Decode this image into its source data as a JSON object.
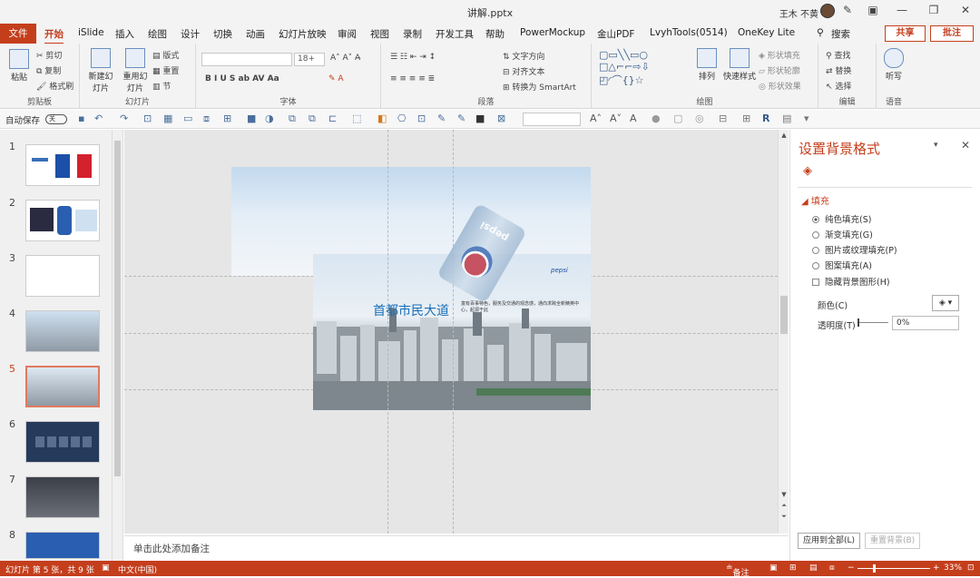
{
  "window": {
    "title": "讲解.pptx",
    "user": "王木 不黄"
  },
  "tabs": [
    {
      "label": "文件"
    },
    {
      "label": "开始"
    },
    {
      "label": "iSlide"
    },
    {
      "label": "插入"
    },
    {
      "label": "绘图"
    },
    {
      "label": "设计"
    },
    {
      "label": "切换"
    },
    {
      "label": "动画"
    },
    {
      "label": "幻灯片放映"
    },
    {
      "label": "审阅"
    },
    {
      "label": "视图"
    },
    {
      "label": "录制"
    },
    {
      "label": "开发工具"
    },
    {
      "label": "帮助"
    },
    {
      "label": "PowerMockup"
    },
    {
      "label": "金山PDF"
    },
    {
      "label": "LvyhTools(0514)"
    },
    {
      "label": "OneKey Lite"
    },
    {
      "label": "搜索"
    }
  ],
  "header_buttons": {
    "share": "共享",
    "comment": "批注"
  },
  "ribbon": {
    "clipboard": {
      "label": "剪贴板",
      "paste": "粘贴",
      "cut": "剪切",
      "copy": "复制",
      "format_painter": "格式刷"
    },
    "slides": {
      "label": "幻灯片",
      "new_slide": "新建幻灯片",
      "reuse": "重用幻灯片",
      "layout": "版式",
      "reset": "重置",
      "section": "节"
    },
    "font": {
      "label": "字体",
      "size": "18+"
    },
    "paragraph": {
      "label": "段落",
      "text_direction": "文字方向",
      "align_text": "对齐文本",
      "smartart": "转换为 SmartArt"
    },
    "drawing": {
      "label": "绘图",
      "arrange": "排列",
      "quick_styles": "快速样式",
      "fill": "形状填充",
      "outline": "形状轮廓",
      "effects": "形状效果"
    },
    "editing": {
      "label": "编辑",
      "find": "查找",
      "replace": "替换",
      "select": "选择"
    },
    "voice": {
      "label": "语音",
      "dictate": "听写"
    }
  },
  "qat": {
    "autosave": "自动保存",
    "toggle": "关"
  },
  "thumbnails": [
    {
      "num": "1"
    },
    {
      "num": "2"
    },
    {
      "num": "3"
    },
    {
      "num": "4"
    },
    {
      "num": "5"
    },
    {
      "num": "6"
    },
    {
      "num": "7"
    },
    {
      "num": "8"
    }
  ],
  "slide": {
    "title": "首都市民大道",
    "subtitle": "富有百事特色，服务及交通的观念感，通向求跨全新精英中心，起源于此",
    "logo": "pepsi",
    "can_text": "pepsi"
  },
  "notes_placeholder": "单击此处添加备注",
  "format_pane": {
    "title": "设置背景格式",
    "section": "填充",
    "options": [
      {
        "label": "纯色填充(S)",
        "type": "radio",
        "checked": true
      },
      {
        "label": "渐变填充(G)",
        "type": "radio",
        "checked": false
      },
      {
        "label": "图片或纹理填充(P)",
        "type": "radio",
        "checked": false
      },
      {
        "label": "图案填充(A)",
        "type": "radio",
        "checked": false
      },
      {
        "label": "隐藏背景图形(H)",
        "type": "checkbox",
        "checked": false
      }
    ],
    "color_label": "颜色(C)",
    "transparency_label": "透明度(T)",
    "transparency_value": "0%",
    "apply_all": "应用到全部(L)",
    "reset_bg": "重置背景(B)"
  },
  "status": {
    "slide_info": "幻灯片 第 5 张，共 9 张",
    "language": "中文(中国)",
    "notes": "备注",
    "zoom": "33%"
  },
  "colors": {
    "accent": "#c43e1c",
    "title_blue": "#1a6fb8"
  }
}
